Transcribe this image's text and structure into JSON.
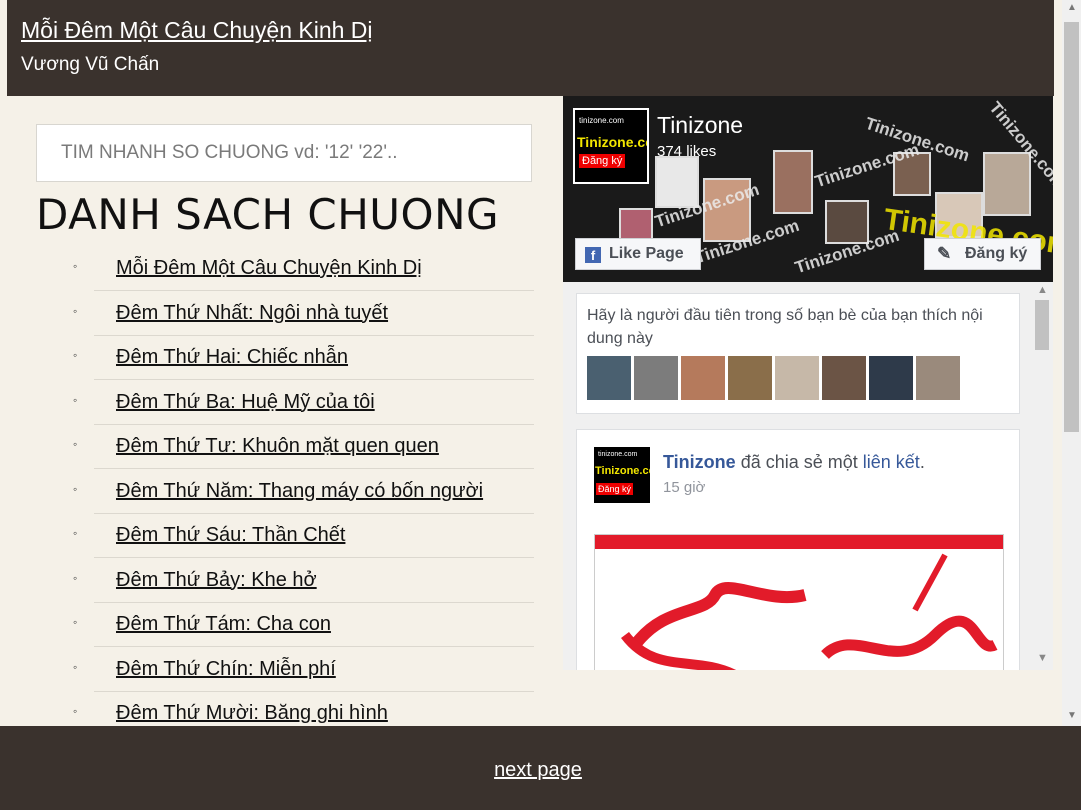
{
  "header": {
    "title": "Mỗi Đêm Một Câu Chuyện Kinh Dị",
    "author": "Vương Vũ Chấn"
  },
  "search": {
    "placeholder": "TIM NHANH SO CHUONG vd: '12' '22'.."
  },
  "chapters": {
    "heading": "DANH SACH CHUONG",
    "items": [
      "Mỗi Đêm Một Câu Chuyện Kinh Dị",
      "Đêm Thứ Nhất: Ngôi nhà tuyết",
      "Đêm Thứ Hai: Chiếc nhẫn",
      "Đêm Thứ Ba: Huệ Mỹ của tôi",
      "Đêm Thứ Tư: Khuôn mặt quen quen",
      "Đêm Thứ Năm: Thang máy có bốn người",
      "Đêm Thứ Sáu: Thần Chết",
      "Đêm Thứ Bảy: Khe hở",
      "Đêm Thứ Tám: Cha con",
      "Đêm Thứ Chín: Miễn phí",
      "Đêm Thứ Mười: Băng ghi hình"
    ]
  },
  "facebook": {
    "page_name": "Tinizone",
    "likes": "374 likes",
    "logo_site": "tinizone.com",
    "logo_brand": "Tinizone.com",
    "logo_badge": "Đăng ký",
    "cover_watermark": "Tinizone.com",
    "like_button": "Like Page",
    "subscribe_button": "Đăng ký",
    "friends_prompt": "Hãy là người đầu tiên trong số bạn bè của bạn thích nội dung này",
    "friend_avatar_colors": [
      "#4a6070",
      "#7c7c7c",
      "#b57a5c",
      "#8a6e4a",
      "#c6b8a8",
      "#6b5445",
      "#2e3a4a",
      "#9a8a7c"
    ],
    "post": {
      "author": "Tinizone",
      "action": "đã chia sẻ một",
      "link_text": "liên kết",
      "time": "15 giờ"
    }
  },
  "footer": {
    "next_page": "next page"
  },
  "colors": {
    "header_bg": "#3a322d",
    "page_bg": "#f5f1e8",
    "fb_blue": "#4267b2",
    "fb_link": "#365899"
  }
}
